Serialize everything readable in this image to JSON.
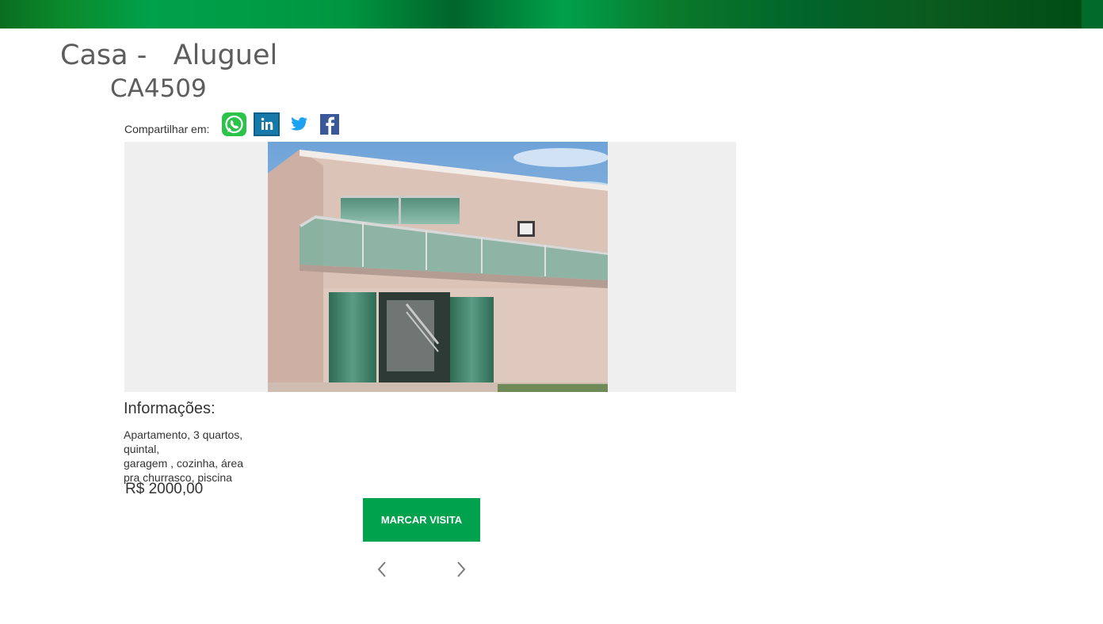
{
  "header": {
    "brand_colors": [
      "#0a6e1f",
      "#00a14b",
      "#004d16"
    ]
  },
  "listing": {
    "title": "Casa -   Aluguel",
    "code": "CA4509",
    "share_label": "Compartilhar em:",
    "share_icons": [
      "whatsapp-icon",
      "linkedin-icon",
      "twitter-icon",
      "facebook-icon"
    ],
    "info_heading": "Informações:",
    "info_lines": [
      "Apartamento, 3 quartos,",
      "quintal,",
      "garagem , cozinha, área",
      "pra churrasco, piscina"
    ],
    "price": "R$ 2000,00",
    "visit_button": "MARCAR VISITA"
  },
  "colors": {
    "accent": "#00a24e",
    "gallery_bg": "#efefef",
    "text": "#333333",
    "title": "#5d5d5d"
  }
}
